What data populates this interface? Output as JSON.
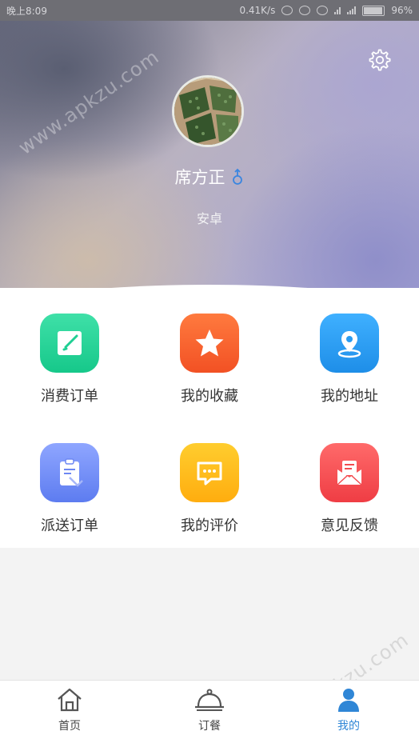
{
  "status_bar": {
    "time": "晚上8:09",
    "network_speed": "0.41K/s",
    "battery": "96%"
  },
  "profile": {
    "name": "席方正",
    "gender_symbol": "♂",
    "platform": "安卓"
  },
  "menu": [
    {
      "label": "消费订单",
      "icon": "edit-icon",
      "color": "#1fcf93"
    },
    {
      "label": "我的收藏",
      "icon": "star-icon",
      "color": "#f55a2a"
    },
    {
      "label": "我的地址",
      "icon": "location-pin-icon",
      "color": "#2a9bf0"
    },
    {
      "label": "派送订单",
      "icon": "clipboard-icon",
      "color": "#6d87f3"
    },
    {
      "label": "我的评价",
      "icon": "comment-icon",
      "color": "#ffb71b"
    },
    {
      "label": "意见反馈",
      "icon": "mail-icon",
      "color": "#f24b50"
    }
  ],
  "bottom_nav": {
    "items": [
      {
        "label": "首页",
        "icon": "home-icon",
        "active": false
      },
      {
        "label": "订餐",
        "icon": "cloche-icon",
        "active": false
      },
      {
        "label": "我的",
        "icon": "person-icon",
        "active": true
      }
    ],
    "active_color": "#2f86d6"
  },
  "watermark": "www.apkzu.com"
}
